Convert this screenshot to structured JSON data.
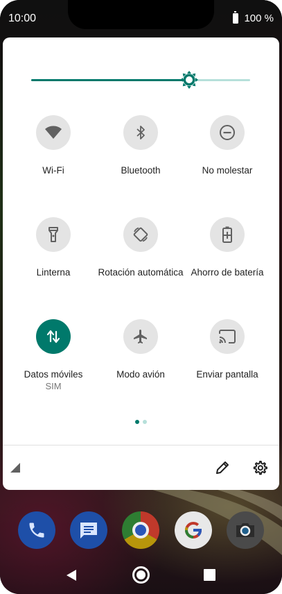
{
  "status_bar": {
    "time": "10:00",
    "battery": "100 %"
  },
  "brightness": {
    "level_fraction": 0.72
  },
  "tiles": [
    {
      "label": "Wi-Fi",
      "icon": "wifi-icon",
      "active": false
    },
    {
      "label": "Bluetooth",
      "icon": "bluetooth-icon",
      "active": false
    },
    {
      "label": "No molestar",
      "icon": "do-not-disturb-icon",
      "active": false
    },
    {
      "label": "Linterna",
      "icon": "flashlight-icon",
      "active": false
    },
    {
      "label": "Rotación automática",
      "icon": "auto-rotate-icon",
      "active": false
    },
    {
      "label": "Ahorro de batería",
      "icon": "battery-saver-icon",
      "active": false
    },
    {
      "label": "Datos móviles",
      "sublabel": "SIM",
      "icon": "mobile-data-icon",
      "active": true
    },
    {
      "label": "Modo avión",
      "icon": "airplane-icon",
      "active": false
    },
    {
      "label": "Enviar pantalla",
      "icon": "cast-icon",
      "active": false
    }
  ],
  "pagination": {
    "current_page": 1,
    "total_pages": 2
  },
  "dock": [
    {
      "icon": "phone-app-icon"
    },
    {
      "icon": "messages-app-icon"
    },
    {
      "icon": "chrome-app-icon"
    },
    {
      "icon": "google-app-icon"
    },
    {
      "icon": "camera-app-icon"
    }
  ],
  "colors": {
    "accent": "#00796b",
    "accent_light": "#b6e0da",
    "tile_inactive": "#e4e4e4",
    "icon_gray": "#616161"
  }
}
